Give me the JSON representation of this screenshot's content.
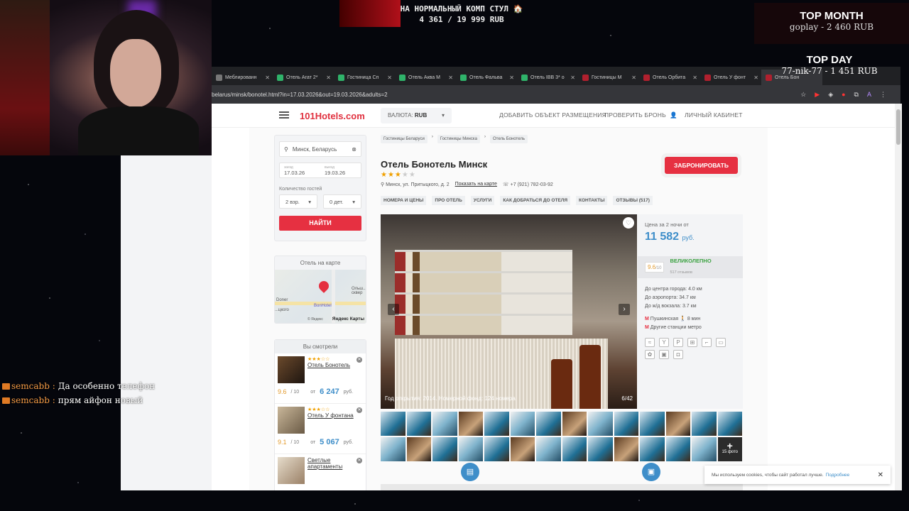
{
  "stream": {
    "banner_line1": "НА НОРМАЛЬНЫЙ КОМП СТУЛ 🏠",
    "banner_line2": "4 361 / 19 999 RUB",
    "top_month_title": "TOP MONTH",
    "top_month_user": "goplay - 2 460 RUB",
    "top_day_title": "TOP DAY",
    "top_day_user": "77-nik-77 - 1 451 RUB"
  },
  "chat": [
    {
      "user": "semcabb :",
      "msg": "Да особенно телефон"
    },
    {
      "user": "semcabb :",
      "msg": "прям айфон новый"
    }
  ],
  "browser": {
    "tabs": [
      "Меблированн",
      "Отель Агат 2*",
      "Гостиница Сп",
      "Отель Аква М",
      "Отель Фальва",
      "Отель IBB 3* о",
      "Гостиницы М",
      "Отель Орбита",
      "Отель У фонт",
      "Отель Бон"
    ],
    "url": "belarus/minsk/bonotel.html?in=17.03.2026&out=19.03.2026&adults=2"
  },
  "header": {
    "logo": "101Hotels.com",
    "currency_label": "ВАЛЮТА:",
    "currency": "RUB",
    "add_property": "ДОБАВИТЬ ОБЪЕКТ РАЗМЕЩЕНИЯ",
    "check_booking": "ПРОВЕРИТЬ БРОНЬ",
    "account": "ЛИЧНЫЙ КАБИНЕТ"
  },
  "search": {
    "city": "Минск, Беларусь",
    "checkin_label": "заезд",
    "checkin": "17.03.26",
    "checkout_label": "выезд",
    "checkout": "19.03.26",
    "guests_label": "Количество гостей",
    "adults": "2 взр.",
    "kids": "0 дет.",
    "find": "НАЙТИ"
  },
  "map": {
    "title": "Отель на карте",
    "pin_label": "BonHotel",
    "place1": "Doner",
    "place2": "Ольш... сквер",
    "place3": "...цкого",
    "copyright": "© Яндекс",
    "brand": "Яндекс Карты"
  },
  "seen": {
    "title": "Вы смотрели",
    "items": [
      {
        "stars": "★★★☆☆",
        "name": "Отель Бонотель",
        "rating": "9.6",
        "rating_max": "/ 10",
        "from": "от",
        "price": "6 247",
        "cur": "руб."
      },
      {
        "stars": "★★★☆☆",
        "name": "Отель У фонтана",
        "rating": "9.1",
        "rating_max": "/ 10",
        "from": "от",
        "price": "5 067",
        "cur": "руб."
      },
      {
        "stars": "",
        "name": "Светлые апартаменты",
        "rating": "",
        "rating_max": "",
        "from": "",
        "price": "",
        "cur": ""
      }
    ]
  },
  "breadcrumbs": [
    "Гостиницы Беларуси",
    "Гостиницы Минска",
    "Отель Бонотель"
  ],
  "hotel": {
    "title": "Отель Бонотель Минск",
    "stars_filled": "★★★",
    "stars_empty": "★★",
    "address": "Минск, ул. Притыцкого, д. 2",
    "map_link": "Показать на карте",
    "phone": "+7 (921) 782-03-92",
    "book": "ЗАБРОНИРОВАТЬ",
    "tabs": [
      "НОМЕРА И ЦЕНЫ",
      "ПРО ОТЕЛЬ",
      "УСЛУГИ",
      "КАК ДОБРАТЬСЯ ДО ОТЕЛЯ",
      "КОНТАКТЫ",
      "ОТЗЫВЫ (517)"
    ],
    "caption": "Год открытия: 2014. Номерной фонд: 124 номера",
    "photo_count": "6/42",
    "more_photos": "15 фото"
  },
  "info": {
    "price_label": "Цена за 2 ночи от",
    "price": "11 582",
    "cur": "руб.",
    "rating": "9.6",
    "rating_max": "/10",
    "verdict": "ВЕЛИКОЛЕПНО",
    "reviews": "517 отзывов",
    "dist": [
      "До центра города: 4.0 км",
      "До аэропорта: 34.7 км",
      "До ж/д вокзала: 3.7 км"
    ],
    "metro": "Пушкинская",
    "metro_time": "8 мин",
    "metro_other": "Другие станции метро"
  },
  "cookie": {
    "text": "Мы используем cookies, чтобы сайт работал лучше.",
    "link": "Подробнее"
  }
}
